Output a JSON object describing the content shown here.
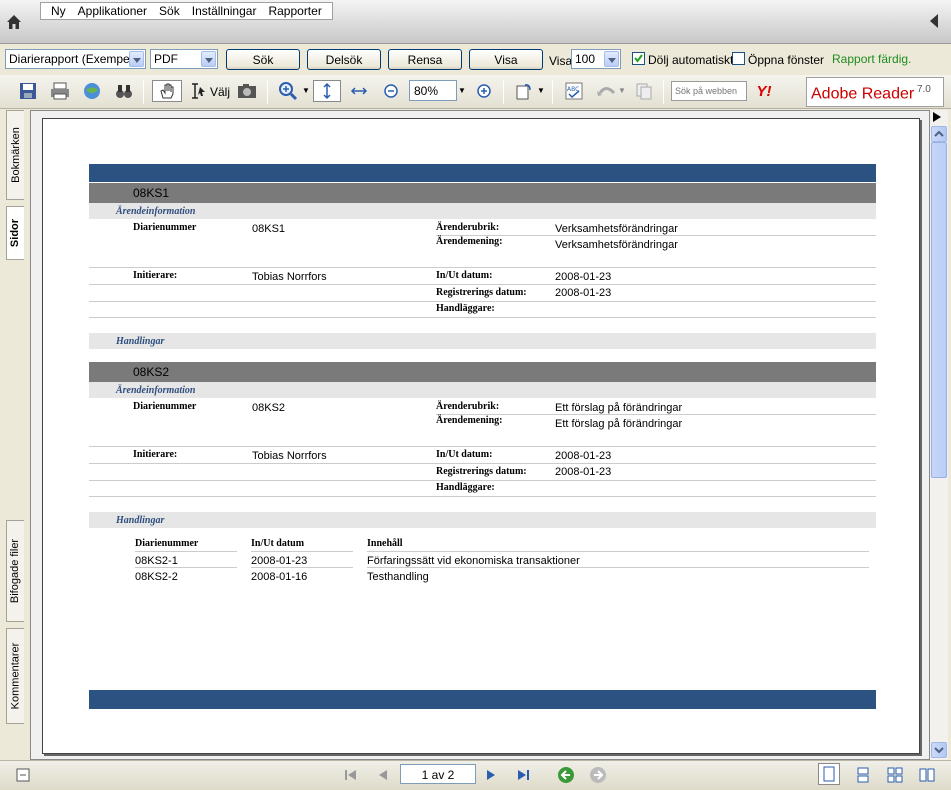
{
  "menu": [
    "Ny",
    "Applikationer",
    "Sök",
    "Inställningar",
    "Rapporter"
  ],
  "filters": {
    "report_select": "Diarierapport (Exempel)",
    "format_select": "PDF",
    "btn_sok": "Sök",
    "btn_delsok": "Delsök",
    "btn_rensa": "Rensa",
    "btn_visa": "Visa",
    "visa_label": "Visa",
    "visa_count": "100",
    "dolj_label": "Dölj automatiskt",
    "oppna_label": "Öppna fönster",
    "status": "Rapport färdig."
  },
  "toolbar": {
    "valj_label": "Välj",
    "zoom": "80%",
    "search_web_placeholder": "Sök på webben",
    "adobe_brand": "Adobe Reader",
    "adobe_version": "7.0"
  },
  "side_tabs": [
    "Bokmärken",
    "Sidor",
    "Bifogade filer",
    "Kommentarer"
  ],
  "pager": {
    "text": "1 av 2"
  },
  "report": {
    "records": [
      {
        "id": "08KS1",
        "section_title": "Ärendeinformation",
        "diarienummer_label": "Diarienummer",
        "diarienummer": "08KS1",
        "rubrik_label": "Ärenderubrik:",
        "rubrik": "Verksamhetsförändringar",
        "mening_label": "Ärendemening:",
        "mening": "Verksamhetsförändringar",
        "initierare_label": "Initierare:",
        "initierare": "Tobias Norrfors",
        "inut_label": "In/Ut datum:",
        "inut": "2008-01-23",
        "reg_label": "Registrerings datum:",
        "reg": "2008-01-23",
        "handlaggare_label": "Handläggare:",
        "handlingar_title": "Handlingar"
      },
      {
        "id": "08KS2",
        "section_title": "Ärendeinformation",
        "diarienummer_label": "Diarienummer",
        "diarienummer": "08KS2",
        "rubrik_label": "Ärenderubrik:",
        "rubrik": "Ett förslag på förändringar",
        "mening_label": "Ärendemening:",
        "mening": "Ett förslag på förändringar",
        "initierare_label": "Initierare:",
        "initierare": "Tobias Norrfors",
        "inut_label": "In/Ut datum:",
        "inut": "2008-01-23",
        "reg_label": "Registrerings datum:",
        "reg": "2008-01-23",
        "handlaggare_label": "Handläggare:",
        "handlingar_title": "Handlingar"
      }
    ],
    "documents": {
      "headers": [
        "Diarienummer",
        "In/Ut datum",
        "Innehåll"
      ],
      "rows": [
        [
          "08KS2-1",
          "2008-01-23",
          "Förfaringssätt vid ekonomiska transaktioner"
        ],
        [
          "08KS2-2",
          "2008-01-16",
          "Testhandling"
        ]
      ]
    }
  }
}
